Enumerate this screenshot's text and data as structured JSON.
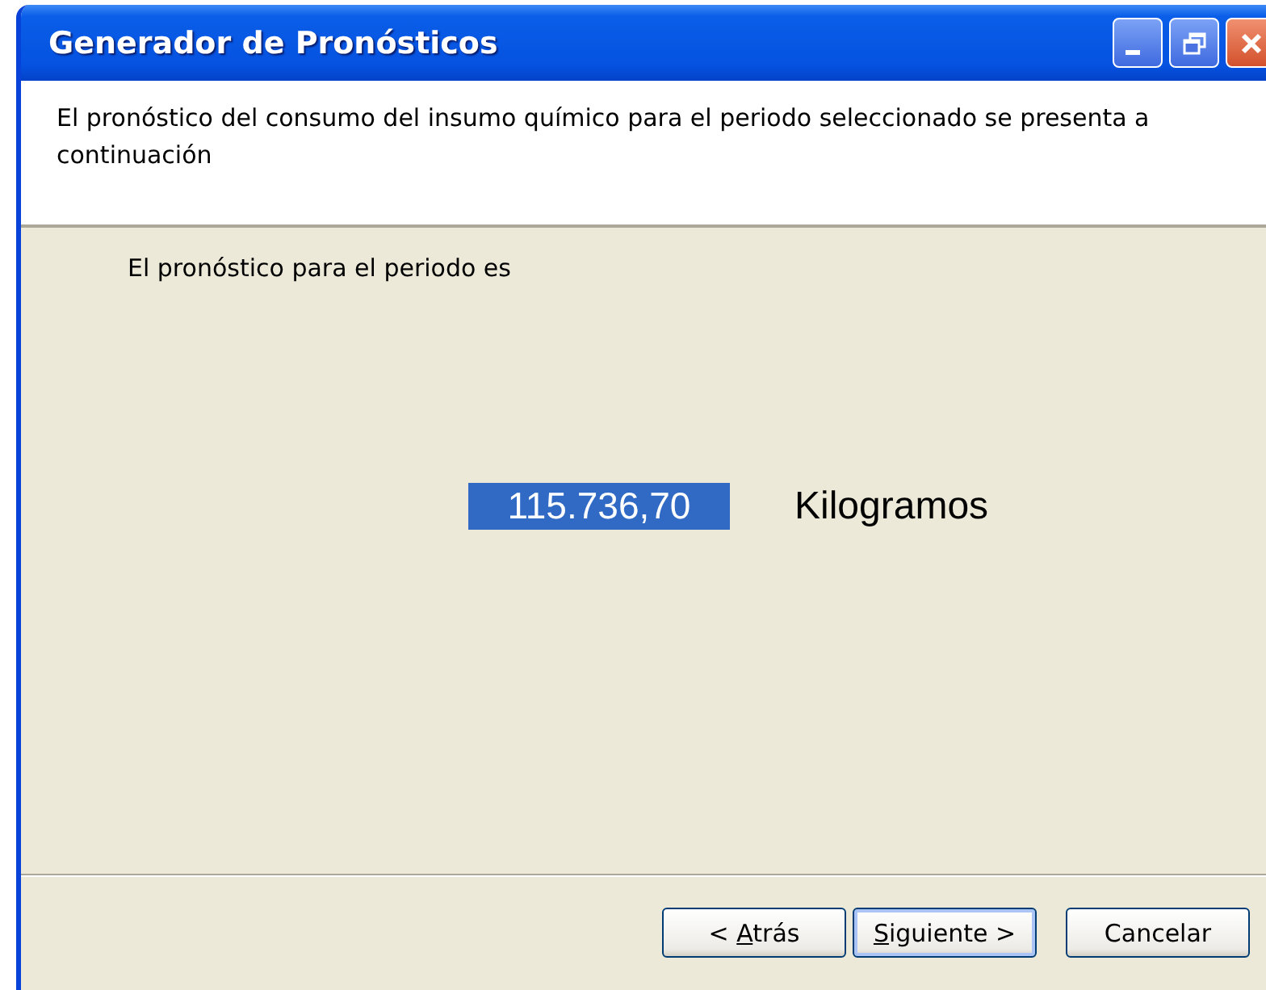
{
  "window": {
    "title": "Generador de Pronósticos"
  },
  "header": {
    "text": "El pronóstico del consumo del insumo químico para el periodo seleccionado se presenta a continuación"
  },
  "body": {
    "label": "El pronóstico para el periodo es",
    "value": {
      "text": "115.736,70",
      "selected": true
    },
    "unit": "Kilogramos"
  },
  "buttons": [
    {
      "kind": "back",
      "before": "< ",
      "accel": "A",
      "after": "trás",
      "default": false
    },
    {
      "kind": "next",
      "accel": "S",
      "after": "iguiente >",
      "default": true
    },
    {
      "kind": "cancel",
      "before": "Cancelar",
      "default": false
    }
  ]
}
